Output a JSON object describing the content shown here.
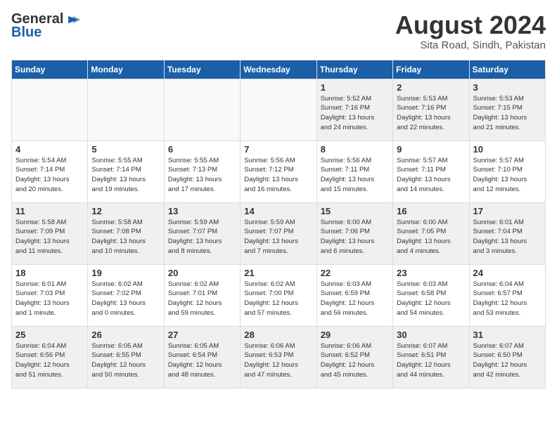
{
  "header": {
    "logo_general": "General",
    "logo_blue": "Blue",
    "month": "August 2024",
    "location": "Sita Road, Sindh, Pakistan"
  },
  "days_of_week": [
    "Sunday",
    "Monday",
    "Tuesday",
    "Wednesday",
    "Thursday",
    "Friday",
    "Saturday"
  ],
  "weeks": [
    [
      {
        "num": "",
        "info": "",
        "empty": true
      },
      {
        "num": "",
        "info": "",
        "empty": true
      },
      {
        "num": "",
        "info": "",
        "empty": true
      },
      {
        "num": "",
        "info": "",
        "empty": true
      },
      {
        "num": "1",
        "info": "Sunrise: 5:52 AM\nSunset: 7:16 PM\nDaylight: 13 hours\nand 24 minutes."
      },
      {
        "num": "2",
        "info": "Sunrise: 5:53 AM\nSunset: 7:16 PM\nDaylight: 13 hours\nand 22 minutes."
      },
      {
        "num": "3",
        "info": "Sunrise: 5:53 AM\nSunset: 7:15 PM\nDaylight: 13 hours\nand 21 minutes."
      }
    ],
    [
      {
        "num": "4",
        "info": "Sunrise: 5:54 AM\nSunset: 7:14 PM\nDaylight: 13 hours\nand 20 minutes."
      },
      {
        "num": "5",
        "info": "Sunrise: 5:55 AM\nSunset: 7:14 PM\nDaylight: 13 hours\nand 19 minutes."
      },
      {
        "num": "6",
        "info": "Sunrise: 5:55 AM\nSunset: 7:13 PM\nDaylight: 13 hours\nand 17 minutes."
      },
      {
        "num": "7",
        "info": "Sunrise: 5:56 AM\nSunset: 7:12 PM\nDaylight: 13 hours\nand 16 minutes."
      },
      {
        "num": "8",
        "info": "Sunrise: 5:56 AM\nSunset: 7:11 PM\nDaylight: 13 hours\nand 15 minutes."
      },
      {
        "num": "9",
        "info": "Sunrise: 5:57 AM\nSunset: 7:11 PM\nDaylight: 13 hours\nand 14 minutes."
      },
      {
        "num": "10",
        "info": "Sunrise: 5:57 AM\nSunset: 7:10 PM\nDaylight: 13 hours\nand 12 minutes."
      }
    ],
    [
      {
        "num": "11",
        "info": "Sunrise: 5:58 AM\nSunset: 7:09 PM\nDaylight: 13 hours\nand 11 minutes."
      },
      {
        "num": "12",
        "info": "Sunrise: 5:58 AM\nSunset: 7:08 PM\nDaylight: 13 hours\nand 10 minutes."
      },
      {
        "num": "13",
        "info": "Sunrise: 5:59 AM\nSunset: 7:07 PM\nDaylight: 13 hours\nand 8 minutes."
      },
      {
        "num": "14",
        "info": "Sunrise: 5:59 AM\nSunset: 7:07 PM\nDaylight: 13 hours\nand 7 minutes."
      },
      {
        "num": "15",
        "info": "Sunrise: 6:00 AM\nSunset: 7:06 PM\nDaylight: 13 hours\nand 6 minutes."
      },
      {
        "num": "16",
        "info": "Sunrise: 6:00 AM\nSunset: 7:05 PM\nDaylight: 13 hours\nand 4 minutes."
      },
      {
        "num": "17",
        "info": "Sunrise: 6:01 AM\nSunset: 7:04 PM\nDaylight: 13 hours\nand 3 minutes."
      }
    ],
    [
      {
        "num": "18",
        "info": "Sunrise: 6:01 AM\nSunset: 7:03 PM\nDaylight: 13 hours\nand 1 minute."
      },
      {
        "num": "19",
        "info": "Sunrise: 6:02 AM\nSunset: 7:02 PM\nDaylight: 13 hours\nand 0 minutes."
      },
      {
        "num": "20",
        "info": "Sunrise: 6:02 AM\nSunset: 7:01 PM\nDaylight: 12 hours\nand 59 minutes."
      },
      {
        "num": "21",
        "info": "Sunrise: 6:02 AM\nSunset: 7:00 PM\nDaylight: 12 hours\nand 57 minutes."
      },
      {
        "num": "22",
        "info": "Sunrise: 6:03 AM\nSunset: 6:59 PM\nDaylight: 12 hours\nand 56 minutes."
      },
      {
        "num": "23",
        "info": "Sunrise: 6:03 AM\nSunset: 6:58 PM\nDaylight: 12 hours\nand 54 minutes."
      },
      {
        "num": "24",
        "info": "Sunrise: 6:04 AM\nSunset: 6:57 PM\nDaylight: 12 hours\nand 53 minutes."
      }
    ],
    [
      {
        "num": "25",
        "info": "Sunrise: 6:04 AM\nSunset: 6:56 PM\nDaylight: 12 hours\nand 51 minutes."
      },
      {
        "num": "26",
        "info": "Sunrise: 6:05 AM\nSunset: 6:55 PM\nDaylight: 12 hours\nand 50 minutes."
      },
      {
        "num": "27",
        "info": "Sunrise: 6:05 AM\nSunset: 6:54 PM\nDaylight: 12 hours\nand 48 minutes."
      },
      {
        "num": "28",
        "info": "Sunrise: 6:06 AM\nSunset: 6:53 PM\nDaylight: 12 hours\nand 47 minutes."
      },
      {
        "num": "29",
        "info": "Sunrise: 6:06 AM\nSunset: 6:52 PM\nDaylight: 12 hours\nand 45 minutes."
      },
      {
        "num": "30",
        "info": "Sunrise: 6:07 AM\nSunset: 6:51 PM\nDaylight: 12 hours\nand 44 minutes."
      },
      {
        "num": "31",
        "info": "Sunrise: 6:07 AM\nSunset: 6:50 PM\nDaylight: 12 hours\nand 42 minutes."
      }
    ]
  ]
}
